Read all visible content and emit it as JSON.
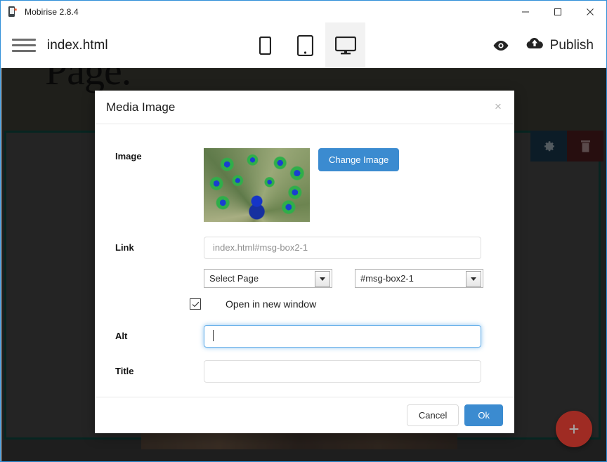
{
  "window": {
    "title": "Mobirise 2.8.4",
    "icon": "mobirise-app-icon",
    "controls": {
      "minimize": "minimize-icon",
      "maximize": "maximize-icon",
      "close": "close-icon"
    }
  },
  "toolbar": {
    "menu_icon": "hamburger-menu-icon",
    "filename": "index.html",
    "devices": [
      {
        "name": "mobile",
        "icon": "mobile-icon",
        "active": false
      },
      {
        "name": "tablet",
        "icon": "tablet-icon",
        "active": false
      },
      {
        "name": "desktop",
        "icon": "desktop-icon",
        "active": true
      }
    ],
    "preview_icon": "eye-icon",
    "publish_icon": "cloud-upload-icon",
    "publish_label": "Publish"
  },
  "canvas": {
    "hero_text": "Page.",
    "block_tools": {
      "settings_icon": "gear-icon",
      "delete_icon": "trash-icon"
    },
    "add_block_label": "+"
  },
  "dialog": {
    "title": "Media Image",
    "close_label": "×",
    "fields": {
      "image": {
        "label": "Image",
        "thumbnail": "peacock-photo-thumbnail",
        "change_button": "Change Image"
      },
      "link": {
        "label": "Link",
        "value": "index.html#msg-box2-1",
        "placeholder": "index.html#msg-box2-1",
        "select_page": "Select Page",
        "select_anchor": "#msg-box2-1"
      },
      "open_new_window": {
        "label": "Open in new window",
        "checked": true
      },
      "alt": {
        "label": "Alt",
        "value": "",
        "placeholder": "",
        "focused": true
      },
      "title": {
        "label": "Title",
        "value": "",
        "placeholder": ""
      }
    },
    "footer": {
      "cancel_label": "Cancel",
      "ok_label": "Ok"
    }
  },
  "colors": {
    "accent_blue": "#3b8bd0",
    "focus_blue": "#66afe9",
    "fab_red": "#f44336",
    "window_border": "#2f8fd8"
  }
}
